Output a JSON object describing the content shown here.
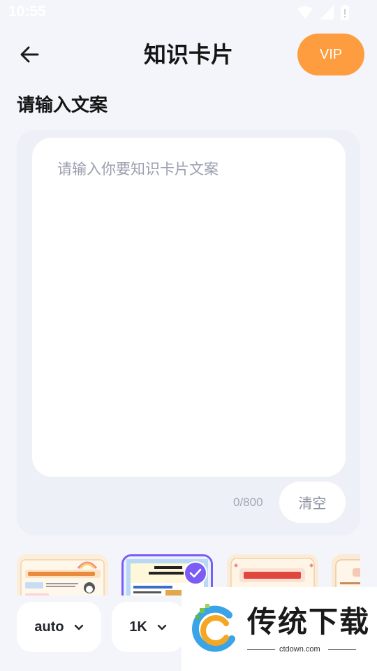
{
  "status_bar": {
    "time": "10:55"
  },
  "header": {
    "title": "知识卡片",
    "vip_label": "VIP"
  },
  "content": {
    "section_label": "请输入文案",
    "placeholder": "请输入你要知识卡片文案",
    "char_count": "0/800",
    "clear_label": "清空"
  },
  "templates": [
    {
      "title": "企鹅为什么不怕冷",
      "selected": false
    },
    {
      "title": "第三单元 万以内数的认识",
      "selected": true
    },
    {
      "title": "周末放松大吉",
      "selected": false
    },
    {
      "title": "",
      "selected": false
    }
  ],
  "bottom": {
    "ratio_label": "auto",
    "resolution_label": "1K"
  },
  "watermark": {
    "title": "传统下载",
    "site": "ctdown.com"
  },
  "colors": {
    "accent": "#fd9d3f",
    "selected": "#7b5cf5",
    "background": "#f4f5fa"
  }
}
